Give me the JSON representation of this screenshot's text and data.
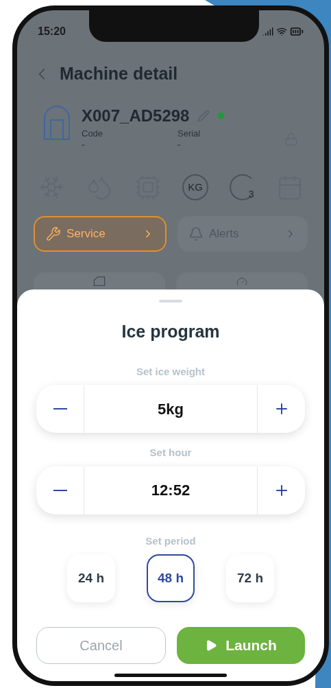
{
  "status_bar": {
    "time": "15:20"
  },
  "header": {
    "title": "Machine detail"
  },
  "machine": {
    "name": "X007_AD5298",
    "online": true,
    "fields": [
      {
        "label": "Code",
        "value": "-"
      },
      {
        "label": "Serial",
        "value": "-"
      }
    ]
  },
  "feature_icons": [
    {
      "kind": "snowflake"
    },
    {
      "kind": "drops"
    },
    {
      "kind": "chip"
    },
    {
      "kind": "weight",
      "label": "KG"
    },
    {
      "kind": "cycle",
      "label": "3"
    },
    {
      "kind": "calendar"
    }
  ],
  "nav_buttons": [
    {
      "kind": "service",
      "label": "Service",
      "selected": true
    },
    {
      "kind": "alerts",
      "label": "Alerts",
      "selected": false
    }
  ],
  "sheet": {
    "title": "Ice program",
    "steppers": [
      {
        "label": "Set ice weight",
        "value": "5kg"
      },
      {
        "label": "Set hour",
        "value": "12:52"
      }
    ],
    "period_label": "Set period",
    "periods": [
      {
        "label": "24 h",
        "selected": false
      },
      {
        "label": "48 h",
        "selected": true
      },
      {
        "label": "72 h",
        "selected": false
      }
    ],
    "cancel": "Cancel",
    "launch": "Launch"
  }
}
